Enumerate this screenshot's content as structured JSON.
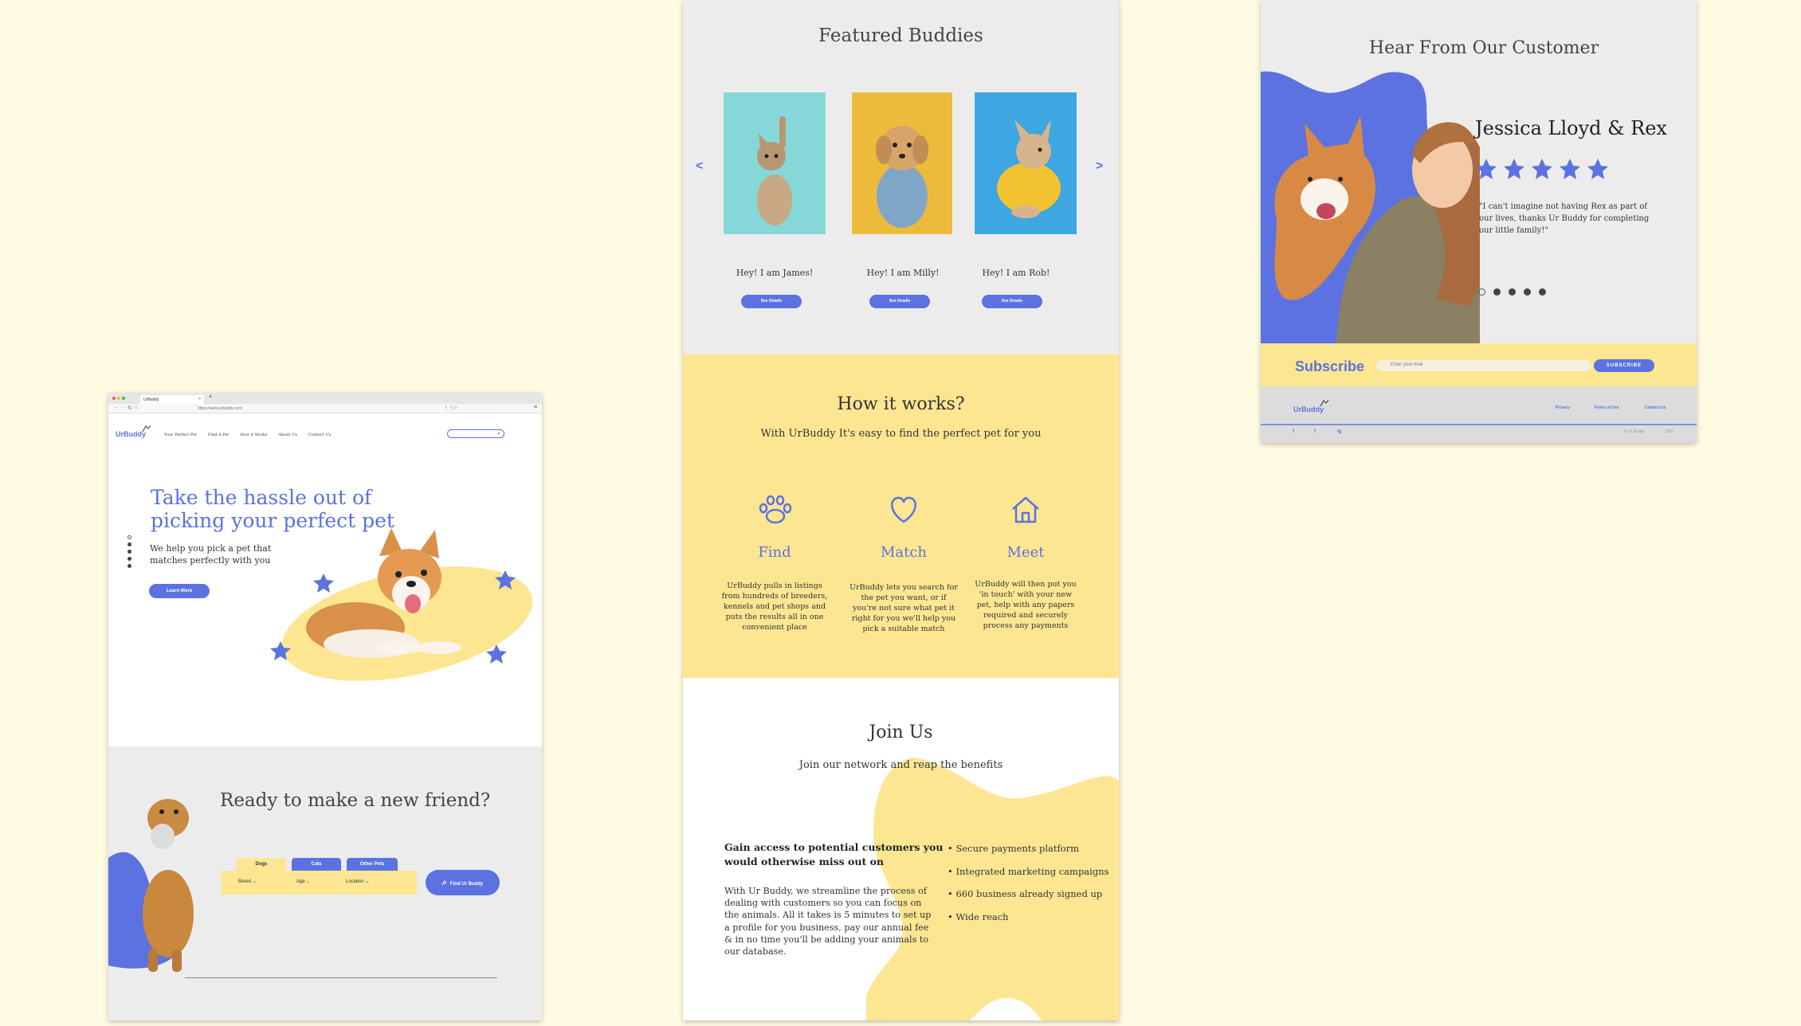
{
  "colors": {
    "page_bg": "#fffbe3",
    "accent_blue": "#5b72e0",
    "accent_yellow": "#fde692",
    "panel_gray": "#ececec"
  },
  "browser": {
    "tab_title": "UrBuddy",
    "url": "https://www.urbuddy.com",
    "new_tab_symbol": "+"
  },
  "left_page": {
    "logo": "UrBuddy",
    "nav": [
      "Your Perfect Pet",
      "Find A Pet",
      "How it Works",
      "About Us",
      "Contact Us"
    ],
    "search_placeholder": "",
    "hero": {
      "heading_line1": "Take the hassle out of",
      "heading_line2": "picking your perfect pet",
      "subtext_line1": "We help you pick a pet that",
      "subtext_line2": "matches perfectly with you",
      "cta": "Learn More"
    },
    "ready": {
      "heading": "Ready to make a new friend?",
      "tabs": [
        "Dogs",
        "Cats",
        "Other Pets"
      ],
      "filters": [
        "Breed",
        "Age",
        "Location"
      ],
      "find_button": "Find Ur Buddy"
    }
  },
  "middle_page": {
    "featured": {
      "title": "Featured Buddies",
      "prev": "<",
      "next": ">",
      "pets": [
        {
          "caption": "Hey! I am James!",
          "button": "See Details",
          "bg": "#86d8d8"
        },
        {
          "caption": "Hey! I am Milly!",
          "button": "See Details",
          "bg": "#ecbb3c"
        },
        {
          "caption": "Hey! I am Rob!",
          "button": "See Details",
          "bg": "#3ea6e0"
        }
      ]
    },
    "how": {
      "title": "How it works?",
      "subtitle": "With UrBuddy It's easy to find the perfect pet for you",
      "steps": [
        {
          "icon": "paw-icon",
          "label": "Find",
          "text": [
            "UrBuddy pulls in listings",
            "from hundreds of breeders,",
            "kennels and pet shops and",
            "puts the results all in one",
            "convenient place"
          ]
        },
        {
          "icon": "heart-icon",
          "label": "Match",
          "text": [
            "UrBuddy lets you search for",
            "the pet you want, or if",
            "you're not sure what pet it",
            "right for you we'll help you",
            "pick a suitable match"
          ]
        },
        {
          "icon": "home-icon",
          "label": "Meet",
          "text": [
            "UrBuddy will then put you",
            "'in touch' with your new",
            "pet, help with any papers",
            "required and securely",
            "process any payments"
          ]
        }
      ]
    },
    "join": {
      "title": "Join Us",
      "subtitle": "Join our network and reap the benefits",
      "lead_line1": "Gain access to potential customers you",
      "lead_line2": "would otherwise miss out on",
      "body": [
        "With Ur Buddy, we streamline the process of",
        "dealing with customers so you can focus on",
        "the animals. All it takes is 5 minutes to set up",
        "a profile for you business, pay our annual fee",
        "& in no time you'll be adding your animals to",
        "our database."
      ],
      "bullets": [
        "Secure payments platform",
        "Integrated marketing campaigns",
        "660 business already signed up",
        "Wide reach"
      ]
    }
  },
  "right_page": {
    "title": "Hear From Our Customer",
    "name": "Jessica Lloyd & Rex",
    "rating": 5,
    "quote": [
      "\"I can't imagine not having Rex as part of",
      "our lives, thanks Ur Buddy for completing",
      "our little family!\""
    ],
    "subscribe": {
      "label": "Subscribe",
      "placeholder": "Enter your mail",
      "button": "SUBSCRIBE"
    },
    "footer": {
      "logo": "UrBuddy",
      "links": [
        "Privacy",
        "Terms of Use",
        "Contact Us"
      ],
      "social": [
        "f",
        "t",
        "ig"
      ],
      "copyright": "© Ur Buddy",
      "year": "2021"
    }
  }
}
